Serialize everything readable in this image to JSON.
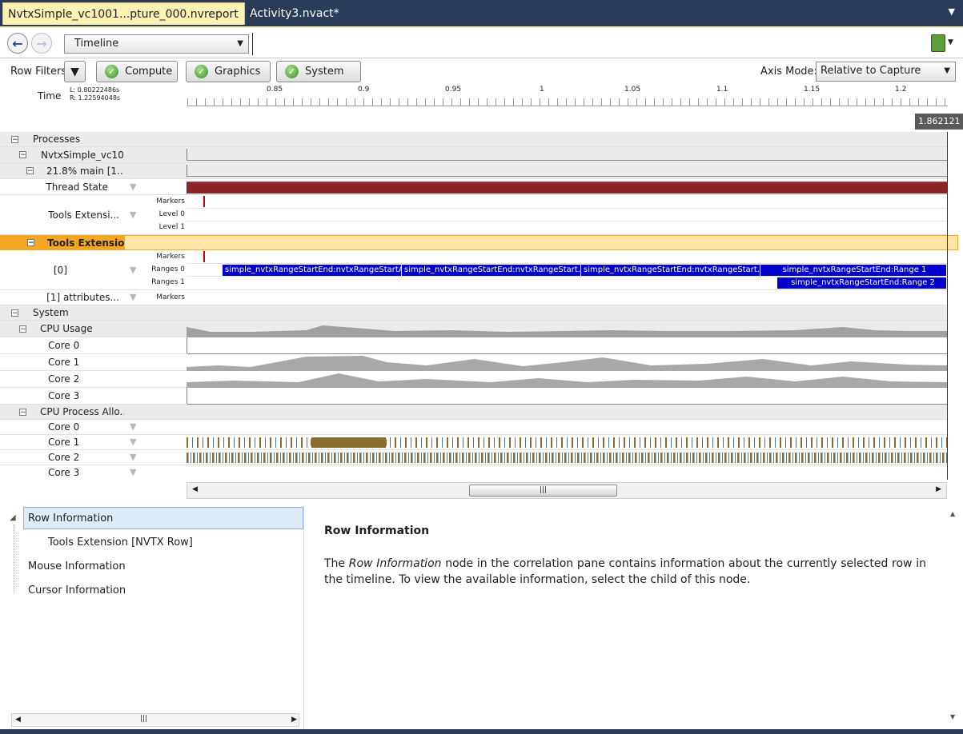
{
  "tabs": [
    {
      "label": "NvtxSimple_vc1001...pture_000.nvreport",
      "active": true,
      "close": "✕"
    },
    {
      "label": "Activity3.nvact*",
      "active": false
    }
  ],
  "tab_menu_icon": "chevron-down-icon",
  "toolbar": {
    "view_select": "Timeline",
    "back_icon": "arrow-left-icon",
    "forward_icon": "arrow-right-icon",
    "report_icon": "document-export-icon"
  },
  "filters": {
    "label": "Row Filters",
    "buttons": [
      "Compute",
      "Graphics",
      "System"
    ],
    "axis_mode_label": "Axis Mode:",
    "axis_mode_value": "Relative to Capture"
  },
  "ruler": {
    "label": "Time",
    "left": "L: 0.80222486s",
    "right": "R: 1.22594048s",
    "ticks": [
      "0.85",
      "0.9",
      "0.95",
      "1",
      "1.05",
      "1.1",
      "1.15",
      "1.2"
    ],
    "cursor_value": "1.862121"
  },
  "rows": {
    "processes": "Processes",
    "process_name": "NvtxSimple_vc10...",
    "thread_name": "21.8% main [1...",
    "thread_state": "Thread State",
    "tools_ext_1": "Tools Extensi...",
    "tools_ext_sub": [
      "Markers",
      "Level 0",
      "Level 1"
    ],
    "tools_ext_selected": "Tools Extension",
    "domain0": "[0]",
    "domain0_sub": [
      "Markers",
      "Ranges 0",
      "Ranges 1"
    ],
    "domain1": "[1]  attributes...",
    "domain1_sub": "Markers",
    "system": "System",
    "cpu_usage": "CPU Usage",
    "cores": [
      "Core 0",
      "Core 1",
      "Core 2",
      "Core 3"
    ],
    "cpu_alloc": "CPU Process Allo..."
  },
  "ranges0": [
    "simple_nvtxRangeStartEnd:nvtxRangeStartA",
    "simple_nvtxRangeStartEnd:nvtxRangeStart...",
    "simple_nvtxRangeStartEnd:nvtxRangeStart...",
    "simple_nvtxRangeStartEnd:Range 1"
  ],
  "ranges1": [
    "simple_nvtxRangeStartEnd:Range 2"
  ],
  "colors": {
    "thread_state": "#8b2424",
    "range": "#0000cc",
    "selection": "#f5a623",
    "tab_active": "#fdf1b4",
    "frame": "#2b3c59"
  },
  "tree": {
    "items": [
      "Row Information",
      "Tools Extension [NVTX Row]",
      "Mouse Information",
      "Cursor Information"
    ]
  },
  "description": {
    "title": "Row Information",
    "body_em": "Row Information",
    "body_pre": "The ",
    "body_post": " node in the correlation pane contains information about the currently selected row in the timeline. To view the available information, select the child of this node."
  }
}
